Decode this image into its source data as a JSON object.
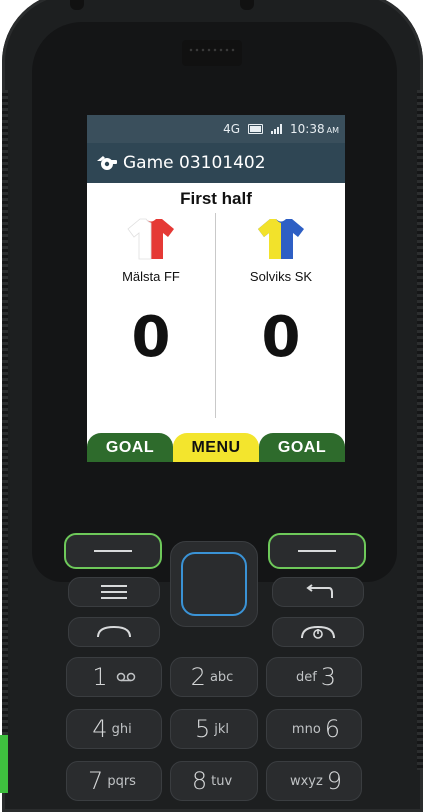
{
  "status_bar": {
    "network": "4G",
    "time": "10:38",
    "ampm": "AM"
  },
  "app": {
    "title": "Game 03101402",
    "title_icon": "whistle-icon"
  },
  "match": {
    "period": "First half",
    "home": {
      "name": "Mälsta FF",
      "score": "0",
      "shirt_colors": [
        "#e53935",
        "#ffffff"
      ]
    },
    "away": {
      "name": "Solviks SK",
      "score": "0",
      "shirt_colors": [
        "#f2e22b",
        "#2e5fc4"
      ]
    }
  },
  "softkeys": {
    "left": "GOAL",
    "center": "MENU",
    "right": "GOAL"
  },
  "keypad": {
    "key1": {
      "num": "1",
      "sub": ""
    },
    "key2": {
      "num": "2",
      "sub": "abc"
    },
    "key3": {
      "num": "3",
      "sub": "def"
    },
    "key4": {
      "num": "4",
      "sub": "ghi"
    },
    "key5": {
      "num": "5",
      "sub": "jkl"
    },
    "key6": {
      "num": "6",
      "sub": "mno"
    },
    "key7": {
      "num": "7",
      "sub": "pqrs"
    },
    "key8": {
      "num": "8",
      "sub": "tuv"
    },
    "key9": {
      "num": "9",
      "sub": "wxyz"
    }
  },
  "colors": {
    "header": "#2f4654",
    "goal_button": "#2e6b2c",
    "menu_button": "#f3e52d",
    "green_key": "#6ec95a",
    "nav_ring": "#3a93d6"
  }
}
